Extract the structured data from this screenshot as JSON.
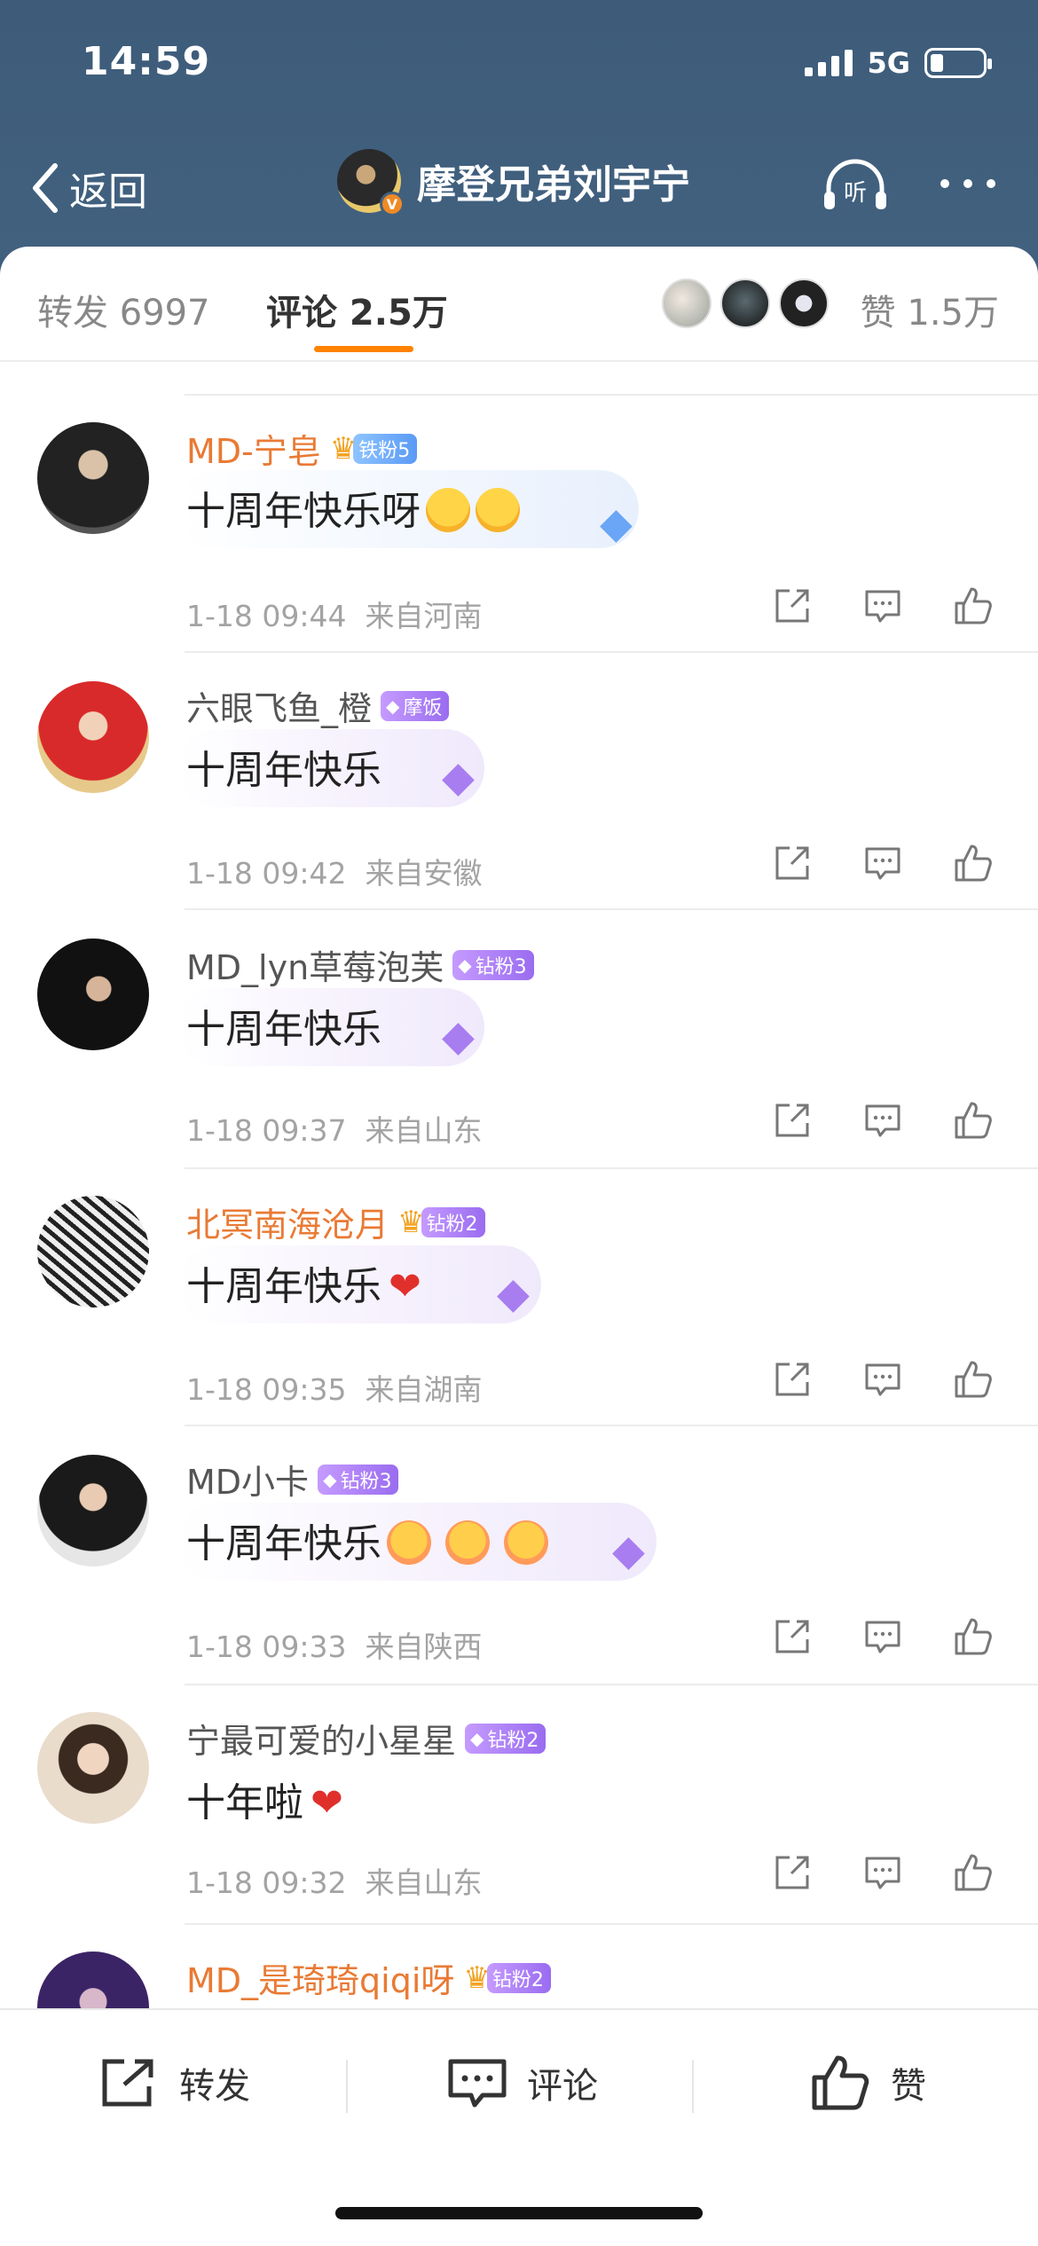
{
  "status_bar": {
    "time": "14:59",
    "network": "5G"
  },
  "nav": {
    "back_label": "返回",
    "title": "摩登兄弟刘宇宁",
    "verified_badge": "V",
    "listen_label": "听"
  },
  "tabs": {
    "repost": "转发 6997",
    "comment": "评论 2.5万",
    "likes": "赞 1.5万"
  },
  "comments": [
    {
      "name": "MD-宁皂",
      "name_color": "#e97a34",
      "badge": "铁粉5",
      "badge_style": "blue",
      "has_crown": true,
      "text": "十周年快乐呀",
      "emojis": [
        "laugh",
        "laugh"
      ],
      "heart": false,
      "time": "1-18 09:44",
      "location": "来自河南"
    },
    {
      "name": "六眼飞鱼_橙",
      "name_color": "#555555",
      "badge": "摩饭",
      "badge_style": "purple",
      "has_crown": false,
      "text": "十周年快乐",
      "emojis": [],
      "heart": false,
      "time": "1-18 09:42",
      "location": "来自安徽"
    },
    {
      "name": "MD_lyn草莓泡芙",
      "name_color": "#555555",
      "badge": "钻粉3",
      "badge_style": "purple",
      "has_crown": false,
      "text": "十周年快乐",
      "emojis": [],
      "heart": false,
      "time": "1-18 09:37",
      "location": "来自山东"
    },
    {
      "name": "北冥南海沧月",
      "name_color": "#e97a34",
      "badge": "钻粉2",
      "badge_style": "purple",
      "has_crown": true,
      "text": "十周年快乐",
      "emojis": [],
      "heart": true,
      "time": "1-18 09:35",
      "location": "来自湖南"
    },
    {
      "name": "MD小卡",
      "name_color": "#555555",
      "badge": "钻粉3",
      "badge_style": "purple",
      "has_crown": false,
      "text": "十周年快乐",
      "emojis": [
        "love",
        "love",
        "love"
      ],
      "heart": false,
      "time": "1-18 09:33",
      "location": "来自陕西"
    },
    {
      "name": "宁最可爱的小星星",
      "name_color": "#555555",
      "badge": "钻粉2",
      "badge_style": "purple",
      "has_crown": false,
      "text": "十年啦",
      "emojis": [],
      "heart": true,
      "time": "1-18 09:32",
      "location": "来自山东"
    },
    {
      "name": "MD_是琦琦qiqi呀",
      "name_color": "#e97a34",
      "badge": "钻粉2",
      "badge_style": "purple",
      "has_crown": true
    }
  ],
  "bottom_bar": {
    "repost": "转发",
    "comment": "评论",
    "like": "赞"
  },
  "icons": [
    "signal-icon",
    "battery-icon",
    "back-chevron-icon",
    "listen-icon",
    "more-icon",
    "share-icon",
    "comment-icon",
    "like-icon"
  ]
}
